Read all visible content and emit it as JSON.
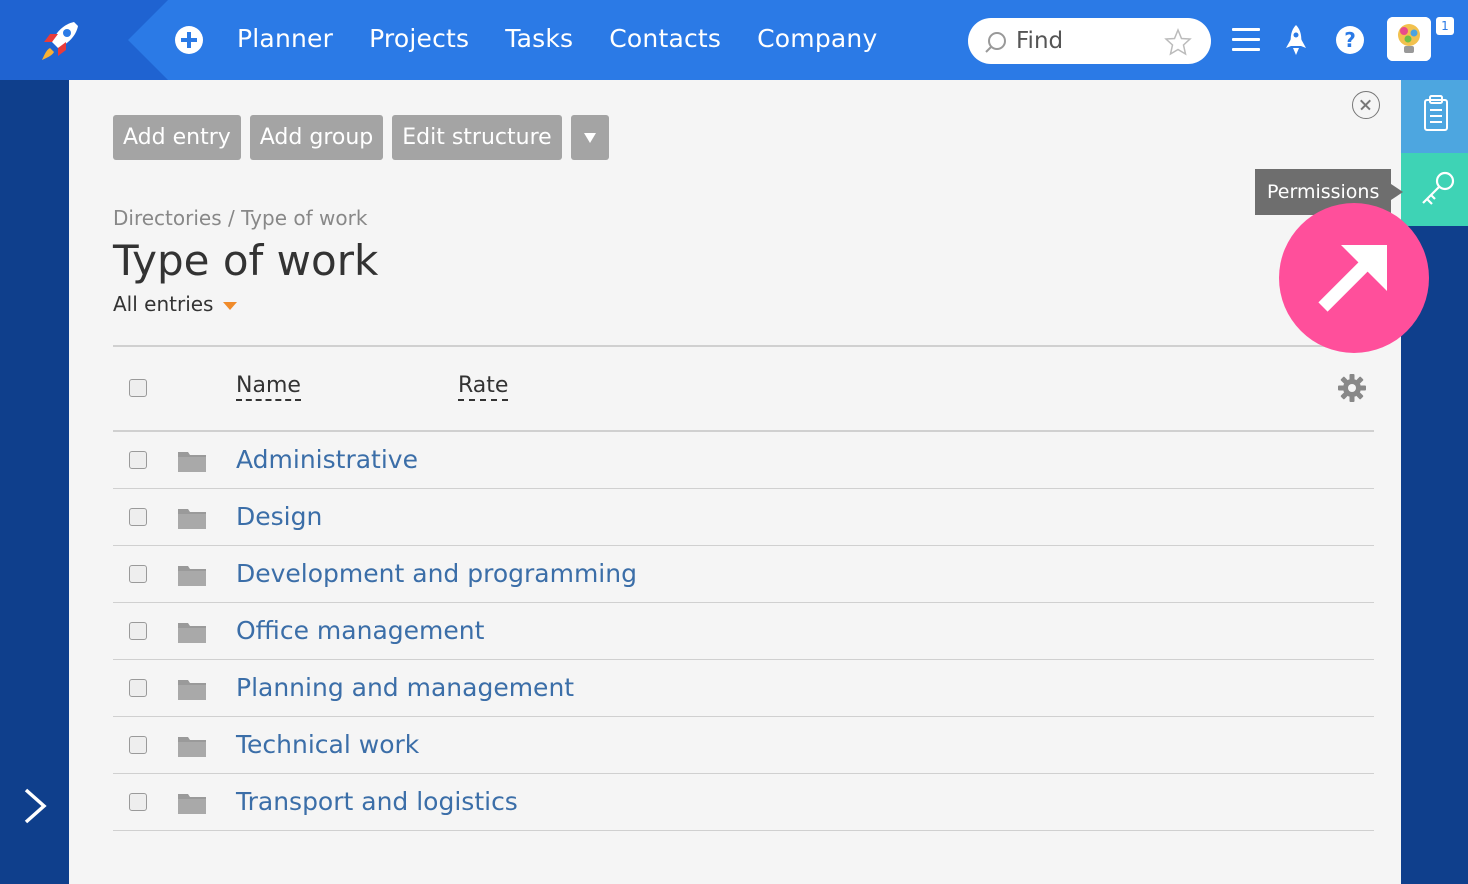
{
  "topbar": {
    "nav": [
      "Planner",
      "Projects",
      "Tasks",
      "Contacts",
      "Company"
    ],
    "search_placeholder": "Find",
    "help_label": "?",
    "notification_count": "1"
  },
  "toolbar": {
    "add_entry": "Add entry",
    "add_group": "Add group",
    "edit_structure": "Edit structure"
  },
  "breadcrumb": {
    "parent": "Directories",
    "separator": " / ",
    "current": "Type of work"
  },
  "page_title": "Type of work",
  "filter_label": "All entries",
  "table": {
    "columns": [
      "Name",
      "Rate"
    ],
    "rows": [
      "Administrative",
      "Design",
      "Development and programming",
      "Office management",
      "Planning and management",
      "Technical work",
      "Transport and logistics"
    ]
  },
  "tooltip": "Permissions",
  "colors": {
    "topbar": "#2b7ae6",
    "background": "#0f3f8c",
    "link": "#3b6ea8",
    "clipboard_tab": "#4da6e0",
    "key_tab": "#3ed3b5",
    "pointer": "#ff4f9b"
  }
}
